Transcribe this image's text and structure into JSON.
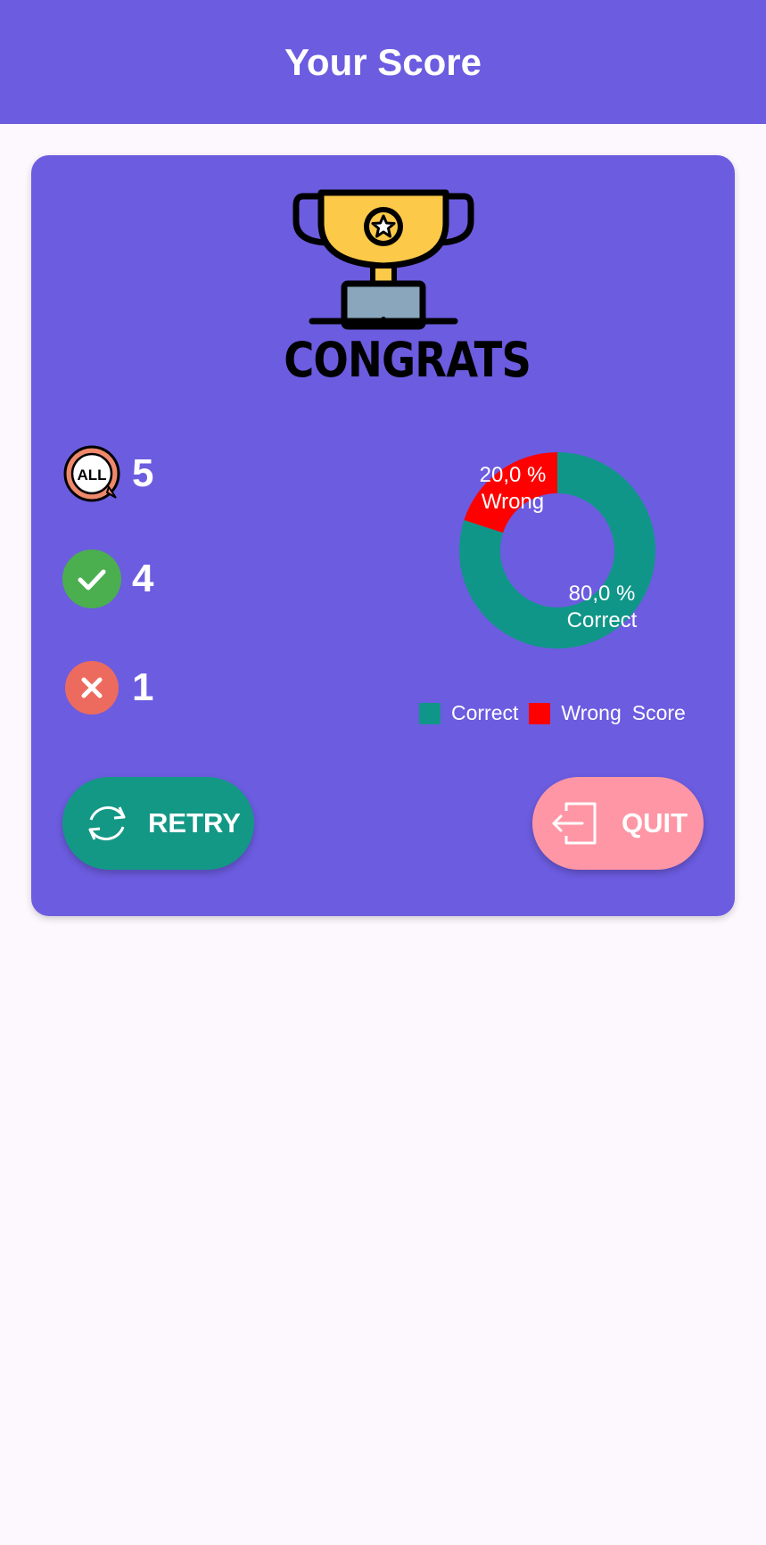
{
  "appbar": {
    "title": "Your Score"
  },
  "hero": {
    "congrats_text": "CONGRATS"
  },
  "stats": {
    "all": {
      "icon": "all-questions-icon",
      "value": "5"
    },
    "correct": {
      "icon": "check-circle-icon",
      "value": "4"
    },
    "wrong": {
      "icon": "x-circle-icon",
      "value": "1"
    }
  },
  "chart_data": {
    "type": "pie",
    "style": "donut",
    "slices": [
      {
        "label": "Correct",
        "value": 80.0,
        "display": "80,0 %",
        "color": "#109688"
      },
      {
        "label": "Wrong",
        "value": 20.0,
        "display": "20,0 %",
        "color": "#ff0000"
      }
    ],
    "legend": [
      "Correct",
      "Wrong"
    ],
    "legend_title": "Score",
    "legend_position": "bottom-right"
  },
  "buttons": {
    "retry": {
      "label": "RETRY",
      "icon": "refresh-icon"
    },
    "quit": {
      "label": "QUIT",
      "icon": "exit-icon"
    }
  },
  "colors": {
    "primary": "#6c5ce0",
    "correct": "#109688",
    "wrong": "#ff0000",
    "retry_button": "#149886",
    "quit_button": "#ff96a5"
  }
}
